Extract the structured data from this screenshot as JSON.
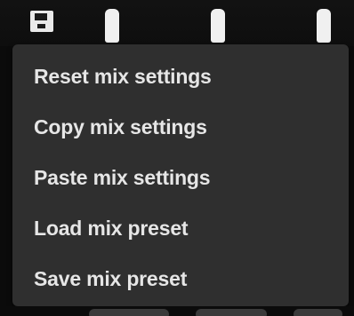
{
  "menu": {
    "items": [
      {
        "label": "Reset mix settings"
      },
      {
        "label": "Copy mix settings"
      },
      {
        "label": "Paste mix settings"
      },
      {
        "label": "Load mix preset"
      },
      {
        "label": "Save mix preset"
      }
    ]
  },
  "icons": {
    "top_left": "save-icon",
    "fader_caps": [
      "fader-cap",
      "fader-cap",
      "fader-cap"
    ]
  },
  "colors": {
    "background": "#0b0b0b",
    "menu_background": "#2f2f2f",
    "menu_text": "#e6e6e6",
    "cap": "#f0f0f0"
  }
}
